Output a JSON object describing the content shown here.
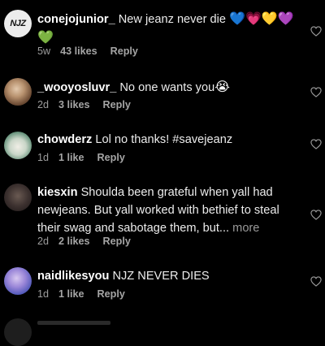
{
  "comments": [
    {
      "username": "conejojunior_",
      "text": "New jeanz never die",
      "emojis": "💙💗💛💜",
      "emoji_line2": "💚",
      "time": "5w",
      "likes": "43 likes",
      "reply": "Reply",
      "avatar_text": "NJZ"
    },
    {
      "username": "_wooyosluvr_",
      "text": "No one wants you",
      "emojis": "😭",
      "time": "2d",
      "likes": "3 likes",
      "reply": "Reply"
    },
    {
      "username": "chowderz",
      "text": "Lol no thanks! #savejeanz",
      "time": "1d",
      "likes": "1 like",
      "reply": "Reply"
    },
    {
      "username": "kiesxin",
      "text_line1": "Shoulda been grateful when yall had",
      "text_line2": "newjeans. But yall worked with bethief to steal",
      "text_line3": "their swag and sabotage them, but...",
      "more": "more",
      "time": "2d",
      "likes": "2 likes",
      "reply": "Reply"
    },
    {
      "username": "naidlikesyou",
      "text": "NJZ NEVER DIES",
      "time": "1d",
      "likes": "1 like",
      "reply": "Reply"
    }
  ],
  "colors": {
    "background": "#000000",
    "username": "#ffffff",
    "meta": "#9d9d9d"
  },
  "icons": [
    "heart-outline-icon"
  ]
}
